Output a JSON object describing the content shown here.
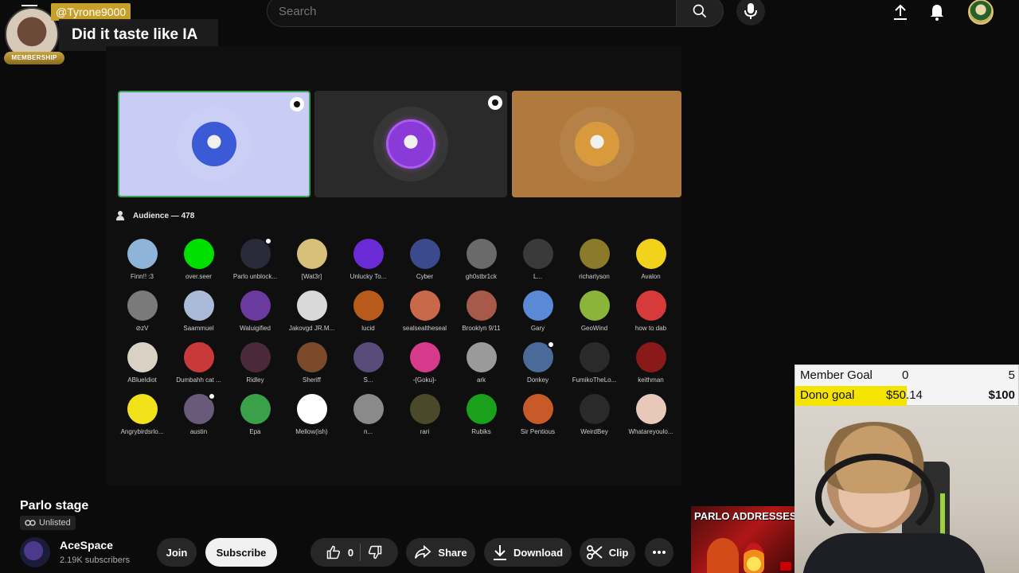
{
  "header": {
    "search_placeholder": "Search"
  },
  "donation": {
    "username": "@Tyrone9000",
    "badge": "MEMBERSHIP",
    "message": "Did it taste like IA"
  },
  "stage": {
    "audience_label": "Audience — 478",
    "speakers": [
      {
        "color": "#c9ccf5",
        "avatar": "#3b5bd6",
        "has_camera": true,
        "highlighted": true
      },
      {
        "color": "#2a2a2a",
        "avatar": "#8a3ad6",
        "has_camera": true,
        "highlighted": false
      },
      {
        "color": "#b07a3e",
        "avatar": "#d89a3c",
        "has_camera": false,
        "highlighted": false
      }
    ],
    "audience": [
      {
        "name": "Finn!! :3",
        "color": "#8fb4d9"
      },
      {
        "name": "over.seer",
        "color": "#00e000"
      },
      {
        "name": "Parlo unblock...",
        "color": "#2a2a3a",
        "dot": true
      },
      {
        "name": "[Wat3r]",
        "color": "#d9c07a"
      },
      {
        "name": "Unlucky To...",
        "color": "#6a2ad6"
      },
      {
        "name": "Cyber",
        "color": "#3a4a8c"
      },
      {
        "name": "gh0stbr1ck",
        "color": "#6a6a6a"
      },
      {
        "name": "L...",
        "color": "#3a3a3a"
      },
      {
        "name": "richarlyson",
        "color": "#8a7a2a"
      },
      {
        "name": "Avalon",
        "color": "#f2d21a"
      },
      {
        "name": "⊘zV",
        "color": "#7a7a7a"
      },
      {
        "name": "Saammuel",
        "color": "#aabbd9"
      },
      {
        "name": "Waluigified",
        "color": "#6a3aa0"
      },
      {
        "name": "Jakovgd JR.M...",
        "color": "#d9d9d9"
      },
      {
        "name": "lucid",
        "color": "#b85a1a"
      },
      {
        "name": "sealsealtheseal",
        "color": "#c86a4a"
      },
      {
        "name": "Brooklyn 9/11",
        "color": "#a85a4a"
      },
      {
        "name": "Gary",
        "color": "#5a8ad6"
      },
      {
        "name": "GeoWind",
        "color": "#8ab43a"
      },
      {
        "name": "how to dab",
        "color": "#d63a3a"
      },
      {
        "name": "ABlueIdiot",
        "color": "#d9d2c4"
      },
      {
        "name": "Dumbahh cat ...",
        "color": "#c83a3a"
      },
      {
        "name": "Ridley",
        "color": "#4a2a3a"
      },
      {
        "name": "Sheriff",
        "color": "#7a4a2a"
      },
      {
        "name": "S...",
        "color": "#5a4a7a"
      },
      {
        "name": "-{Goku}-",
        "color": "#d63a8a"
      },
      {
        "name": "ark",
        "color": "#9a9a9a"
      },
      {
        "name": "Donkey",
        "color": "#4a6a9a",
        "dot": true
      },
      {
        "name": "FumikoTheLo...",
        "color": "#2a2a2a"
      },
      {
        "name": "keithman",
        "color": "#8a1a1a"
      },
      {
        "name": "Angrybirdsrlo...",
        "color": "#f2e21a"
      },
      {
        "name": "austin",
        "color": "#6a5a7a",
        "dot": true
      },
      {
        "name": "Epa",
        "color": "#3aa04a"
      },
      {
        "name": "Mellow(ish)",
        "color": "#ffffff"
      },
      {
        "name": "n...",
        "color": "#8a8a8a"
      },
      {
        "name": "rari",
        "color": "#4a4a2a"
      },
      {
        "name": "Rubiks",
        "color": "#1aa01a"
      },
      {
        "name": "Sir Pentious",
        "color": "#c85a2a"
      },
      {
        "name": "WeirdBey",
        "color": "#2a2a2a"
      },
      {
        "name": "Whatareyoulo...",
        "color": "#e8c8b8"
      }
    ]
  },
  "video": {
    "title": "Parlo stage",
    "visibility": "Unlisted",
    "channel": "AceSpace",
    "subscribers": "2.19K subscribers",
    "join": "Join",
    "subscribe": "Subscribe",
    "likes": "0",
    "share": "Share",
    "download": "Download",
    "clip": "Clip"
  },
  "goals": {
    "member_label": "Member Goal",
    "member_current": "0",
    "member_target": "5",
    "dono_label": "Dono goal",
    "dono_current": "$50.14",
    "dono_target": "$100",
    "dono_progress": 0.5014
  },
  "thumbnail": {
    "text": "PARLO ADDRESSES TI SITUATION"
  }
}
